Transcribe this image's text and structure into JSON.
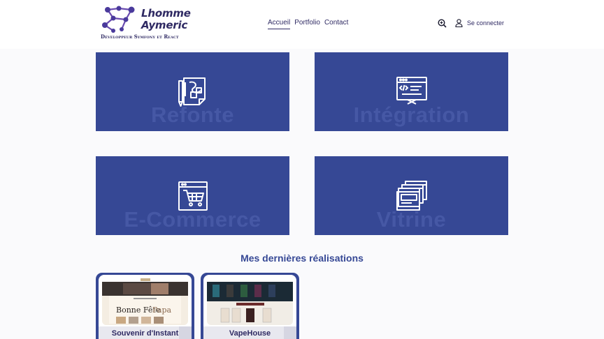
{
  "brand": {
    "name_line1": "Lhomme",
    "name_line2": "Aymeric",
    "tagline": "Développeur Symfony et React"
  },
  "nav": {
    "items": [
      "Accueil",
      "Portfolio",
      "Contact"
    ],
    "active": "Accueil"
  },
  "header": {
    "search_icon": "zoom-in-icon",
    "login_icon": "user-icon",
    "login_label": "Se connecter"
  },
  "services": [
    {
      "title": "Refonte",
      "icon": "design-tablet-icon"
    },
    {
      "title": "Intégration",
      "icon": "code-window-icon"
    },
    {
      "title": "E-Commerce",
      "icon": "cart-window-icon"
    },
    {
      "title": "Vitrine",
      "icon": "stacked-pages-icon"
    }
  ],
  "portfolio": {
    "title": "Mes dernières réalisations",
    "items": [
      {
        "label": "Souvenir d'Instant"
      },
      {
        "label": "VapeHouse"
      }
    ]
  },
  "colors": {
    "primary": "#364895",
    "text_dark": "#2f2a63",
    "background": "#fafafc"
  }
}
